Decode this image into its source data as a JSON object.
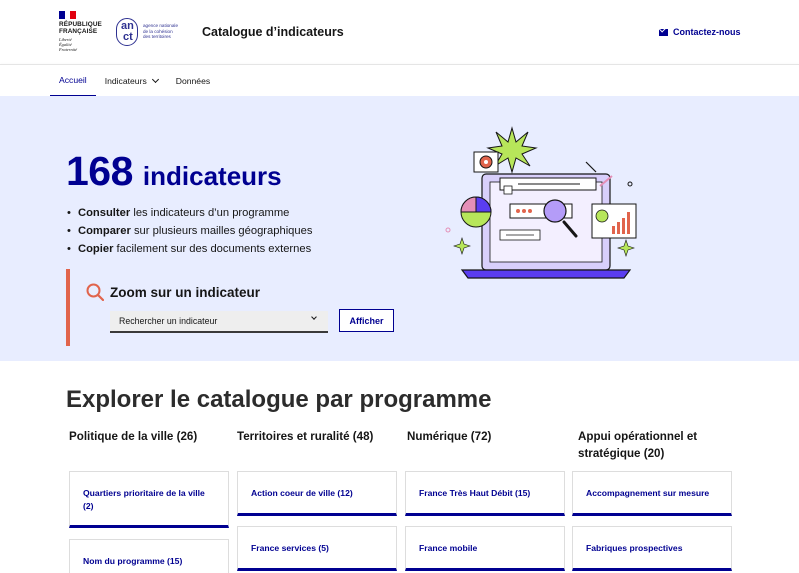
{
  "header": {
    "republique": "RÉPUBLIQUE\nFRANÇAISE",
    "motto": "Liberté\nÉgalité\nFraternité",
    "anct_an": "an",
    "anct_ct": "ct",
    "anct_text": "agence nationale\nde la cohésion\ndes territoires",
    "site_title": "Catalogue d’indicateurs",
    "contact": "Contactez-nous",
    "contact_icon": "mail-icon",
    "flag_colors": [
      "#000091",
      "#ffffff",
      "#e1000f"
    ]
  },
  "nav": {
    "items": [
      {
        "label": "Accueil",
        "active": true
      },
      {
        "label": "Indicateurs",
        "dropdown": true
      },
      {
        "label": "Données"
      }
    ]
  },
  "hero": {
    "count": "168",
    "count_label": "indicateurs",
    "bullets": [
      {
        "bold": "Consulter",
        "rest": " les indicateurs d’un programme"
      },
      {
        "bold": "Comparer",
        "rest": " sur plusieurs mailles géographiques"
      },
      {
        "bold": "Copier",
        "rest": " facilement sur des documents externes"
      }
    ],
    "zoom_title": "Zoom sur un indicateur",
    "select_value": "Rechercher un indicateur",
    "button": "Afficher",
    "accent": "#e1644c",
    "brand": "#000091"
  },
  "catalogue": {
    "title": "Explorer le catalogue par programme",
    "columns": [
      {
        "heading": "Politique de la ville (26)",
        "cards": [
          "Quartiers prioritaire de la ville (2)",
          "Nom du programme (15)"
        ]
      },
      {
        "heading": "Territoires et ruralité (48)",
        "cards": [
          "Action coeur de ville (12)",
          "France services (5)"
        ]
      },
      {
        "heading": "Numérique (72)",
        "cards": [
          "France Très Haut Débit (15)",
          "France mobile"
        ]
      },
      {
        "heading": "Appui opérationnel et stratégique (20)",
        "cards": [
          "Accompagnement sur mesure",
          "Fabriques prospectives"
        ]
      }
    ]
  }
}
